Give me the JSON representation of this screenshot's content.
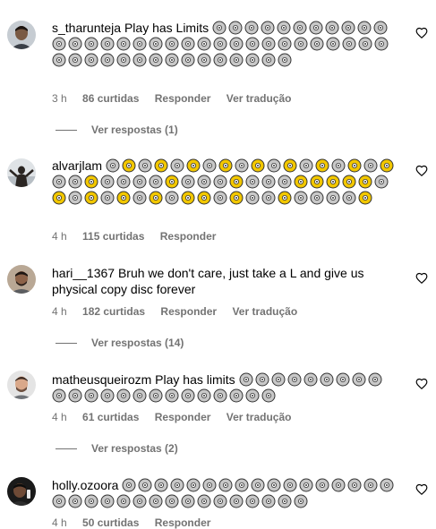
{
  "colors": {
    "text": "#000000",
    "secondary": "#737373",
    "emoji_gray": "#c8c8c8",
    "emoji_gold": "#f2c700"
  },
  "icons": {
    "disc": "optical-disc-emoji",
    "like": "heart-outline-icon"
  },
  "comments": [
    {
      "username": "s_tharunteja",
      "text": "Play has Limits",
      "emoji_pattern": "GGGGGGGGGGGGGGGGGGGGGGGGGGGGGGGGGGGGGGGGGGGGGGG",
      "time": "3 h",
      "likes": "86 curtidas",
      "reply": "Responder",
      "translate": "Ver tradução",
      "view_replies": "Ver respostas (1)"
    },
    {
      "username": "alvarjlam",
      "text": "",
      "emoji_pattern": "GYGYGYGYGYGYGYGYGYGGYGGGGYGGGYGGGYYYYYGYGYGYGYGYYGYGGYGGGGY",
      "time": "4 h",
      "likes": "115 curtidas",
      "reply": "Responder",
      "translate": "",
      "view_replies": ""
    },
    {
      "username": "hari__1367",
      "text": "Bruh we don't care, just take a L and give us physical copy disc forever",
      "emoji_pattern": "",
      "time": "4 h",
      "likes": "182 curtidas",
      "reply": "Responder",
      "translate": "Ver tradução",
      "view_replies": "Ver respostas (14)"
    },
    {
      "username": "matheusqueirozm",
      "text": "Play has limits",
      "emoji_pattern": "GGGGGGGGGGGGGGGGGGGGGGG",
      "time": "4 h",
      "likes": "61 curtidas",
      "reply": "Responder",
      "translate": "Ver tradução",
      "view_replies": "Ver respostas (2)"
    },
    {
      "username": "holly.ozoora",
      "text": "",
      "emoji_pattern": "GGGGGGGGGGGGGGGGGGGGGGGGGGGGGGGGG",
      "time": "4 h",
      "likes": "50 curtidas",
      "reply": "Responder",
      "translate": "",
      "view_replies": ""
    }
  ]
}
